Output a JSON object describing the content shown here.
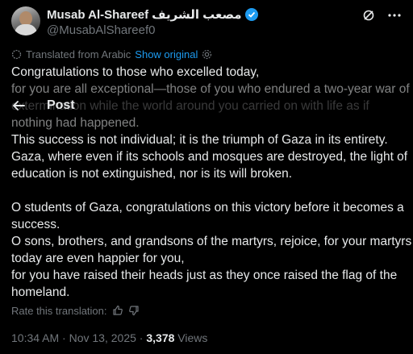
{
  "author": {
    "name": "Musab Al-Shareef",
    "name_arabic": "مصعب الشريف",
    "handle": "@MusabAlShareef0"
  },
  "header": {
    "icons": [
      "grok-icon",
      "more-icon"
    ]
  },
  "translation": {
    "label": "Translated from Arabic",
    "show_original": "Show original",
    "icon": "gear-icon"
  },
  "nav": {
    "title": "Post",
    "back_icon": "back-arrow-icon"
  },
  "tweet": {
    "lines": [
      "Congratulations to those who excelled today,",
      "for you are all exceptional—those of you who endured a two-year war of",
      "extermination while the world around you carried on with life as if",
      "nothing had happened.",
      "This success is not individual; it is the triumph of Gaza in its entirety.",
      "Gaza, where even if its schools and mosques are destroyed, the light of",
      "education is not extinguished, nor is its will broken.",
      "",
      "O students of Gaza, congratulations on this victory before it becomes a",
      "success.",
      "O sons, brothers, and grandsons of the martyrs, rejoice, for your martyrs",
      "today are even happier for you,",
      "for you have raised their heads just as they once raised the flag of the",
      "homeland."
    ]
  },
  "rating": {
    "label": "Rate this translation:",
    "icons": [
      "thumbs-up-icon",
      "thumbs-down-icon"
    ]
  },
  "meta": {
    "time": "10:34 AM",
    "separator": " · ",
    "date": "Nov 13, 2025",
    "views_count": "3,378",
    "views_label": "Views"
  },
  "colors": {
    "background": "#000000",
    "text": "#e7e9ea",
    "muted": "#71767b",
    "accent": "#1d9bf0"
  }
}
